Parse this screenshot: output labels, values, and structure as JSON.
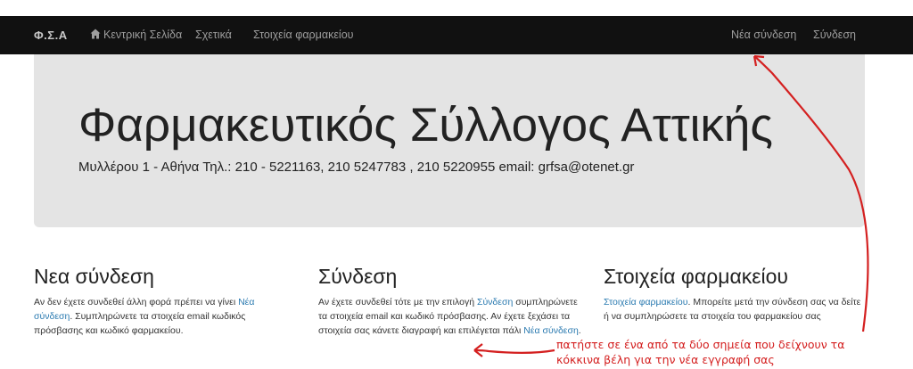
{
  "navbar": {
    "brand": "Φ.Σ.Α",
    "home_label": "Κεντρική Σελίδα",
    "about_label": "Σχετικά",
    "pharmacy_label": "Στοιχεία φαρμακείου",
    "register_label": "Νέα σύνδεση",
    "login_label": "Σύνδεση",
    "home_icon": "home-icon"
  },
  "jumbotron": {
    "title": "Φαρμακευτικός Σύλλογος Αττικής",
    "subtitle": "Μυλλέρου 1 - Αθήνα Τηλ.: 210 - 5221163, 210 5247783 , 210 5220955 email: grfsa@otenet.gr"
  },
  "columns": {
    "register": {
      "heading": "Νεα σύνδεση",
      "text_1": "Αν δεν έχετε συνδεθεί άλλη φορά πρέπει να γίνει ",
      "link_1": "Νέα σύνδεση",
      "text_2": ". Συμπληρώνετε τα στοιχεία email κωδικός πρόσβασης και κωδικό φαρμακείου."
    },
    "login": {
      "heading": "Σύνδεση",
      "text_1": "Αν έχετε συνδεθεί τότε με την επιλογή ",
      "link_1": "Σύνδεση",
      "text_2": " συμπληρώνετε τα στοιχεία email και κωδικό πρόσβασης. Αν έχετε ξεχάσει τα στοιχεία σας κάνετε διαγραφή και επιλέγεται πάλι ",
      "link_2": "Νέα σύνδεση",
      "text_3": "."
    },
    "pharmacy": {
      "heading": "Στοιχεία φαρμακείου",
      "link_1": "Στοιχεία φαρμακείου",
      "text_1": ". Μπορείτε μετά την σύνδεση σας να δείτε ή να συμπληρώσετε τα στοιχεία του φαρμακείου σας"
    }
  },
  "annotation": {
    "line_1": "πατήστε σε ένα από τα δύο σημεία που δείχνουν τα",
    "line_2": "κόκκινα βέλη για την νέα εγγραφή σας",
    "color": "#d42020"
  },
  "colors": {
    "navbar_bg": "#111111",
    "nav_text": "#9d9d9d",
    "jumbotron_bg": "#e4e4e4",
    "link": "#2a7ab0"
  }
}
